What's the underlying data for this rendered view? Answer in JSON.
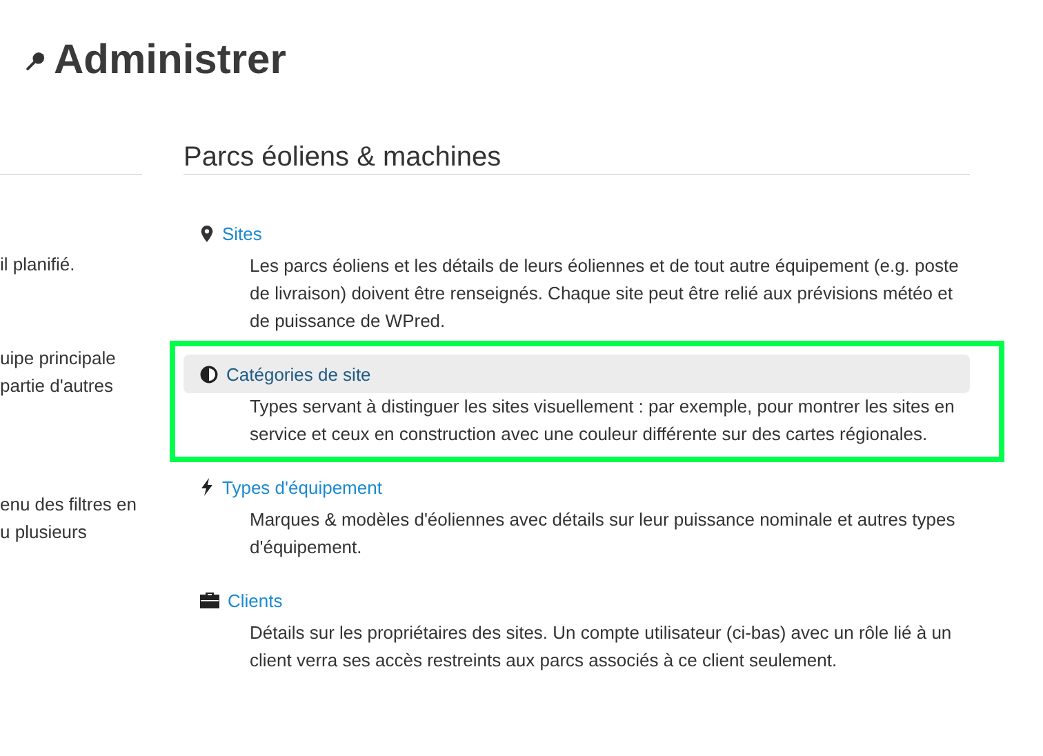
{
  "page_title": "Administrer",
  "left_column": {
    "paragraphs": [
      [
        "il planifié."
      ],
      [
        "uipe principale",
        "partie d'autres"
      ],
      [
        "enu des filtres en",
        "u plusieurs"
      ]
    ]
  },
  "section": {
    "title": "Parcs éoliens & machines",
    "items": [
      {
        "kind": "pin",
        "label": "Sites",
        "highlighted": false,
        "description": "Les parcs éoliens et les détails de leurs éoliennes et de tout autre équipement (e.g. poste de livraison) doivent être renseignés. Chaque site peut être relié aux prévisions météo et de puissance de WPred."
      },
      {
        "kind": "contrast",
        "label": "Catégories de site",
        "highlighted": true,
        "description": "Types servant à distinguer les sites visuellement : par exemple, pour montrer les sites en service et ceux en construction avec une couleur différente sur des cartes régionales."
      },
      {
        "kind": "bolt",
        "label": "Types d'équipement",
        "highlighted": false,
        "description": "Marques & modèles d'éoliennes avec détails sur leur puissance nominale et autres types d'équipement."
      },
      {
        "kind": "briefcase",
        "label": "Clients",
        "highlighted": false,
        "description": "Détails sur les propriétaires des sites. Un compte utilisateur (ci-bas) avec un rôle lié à un client verra ses accès restreints aux parcs associés à ce client seulement."
      }
    ]
  }
}
